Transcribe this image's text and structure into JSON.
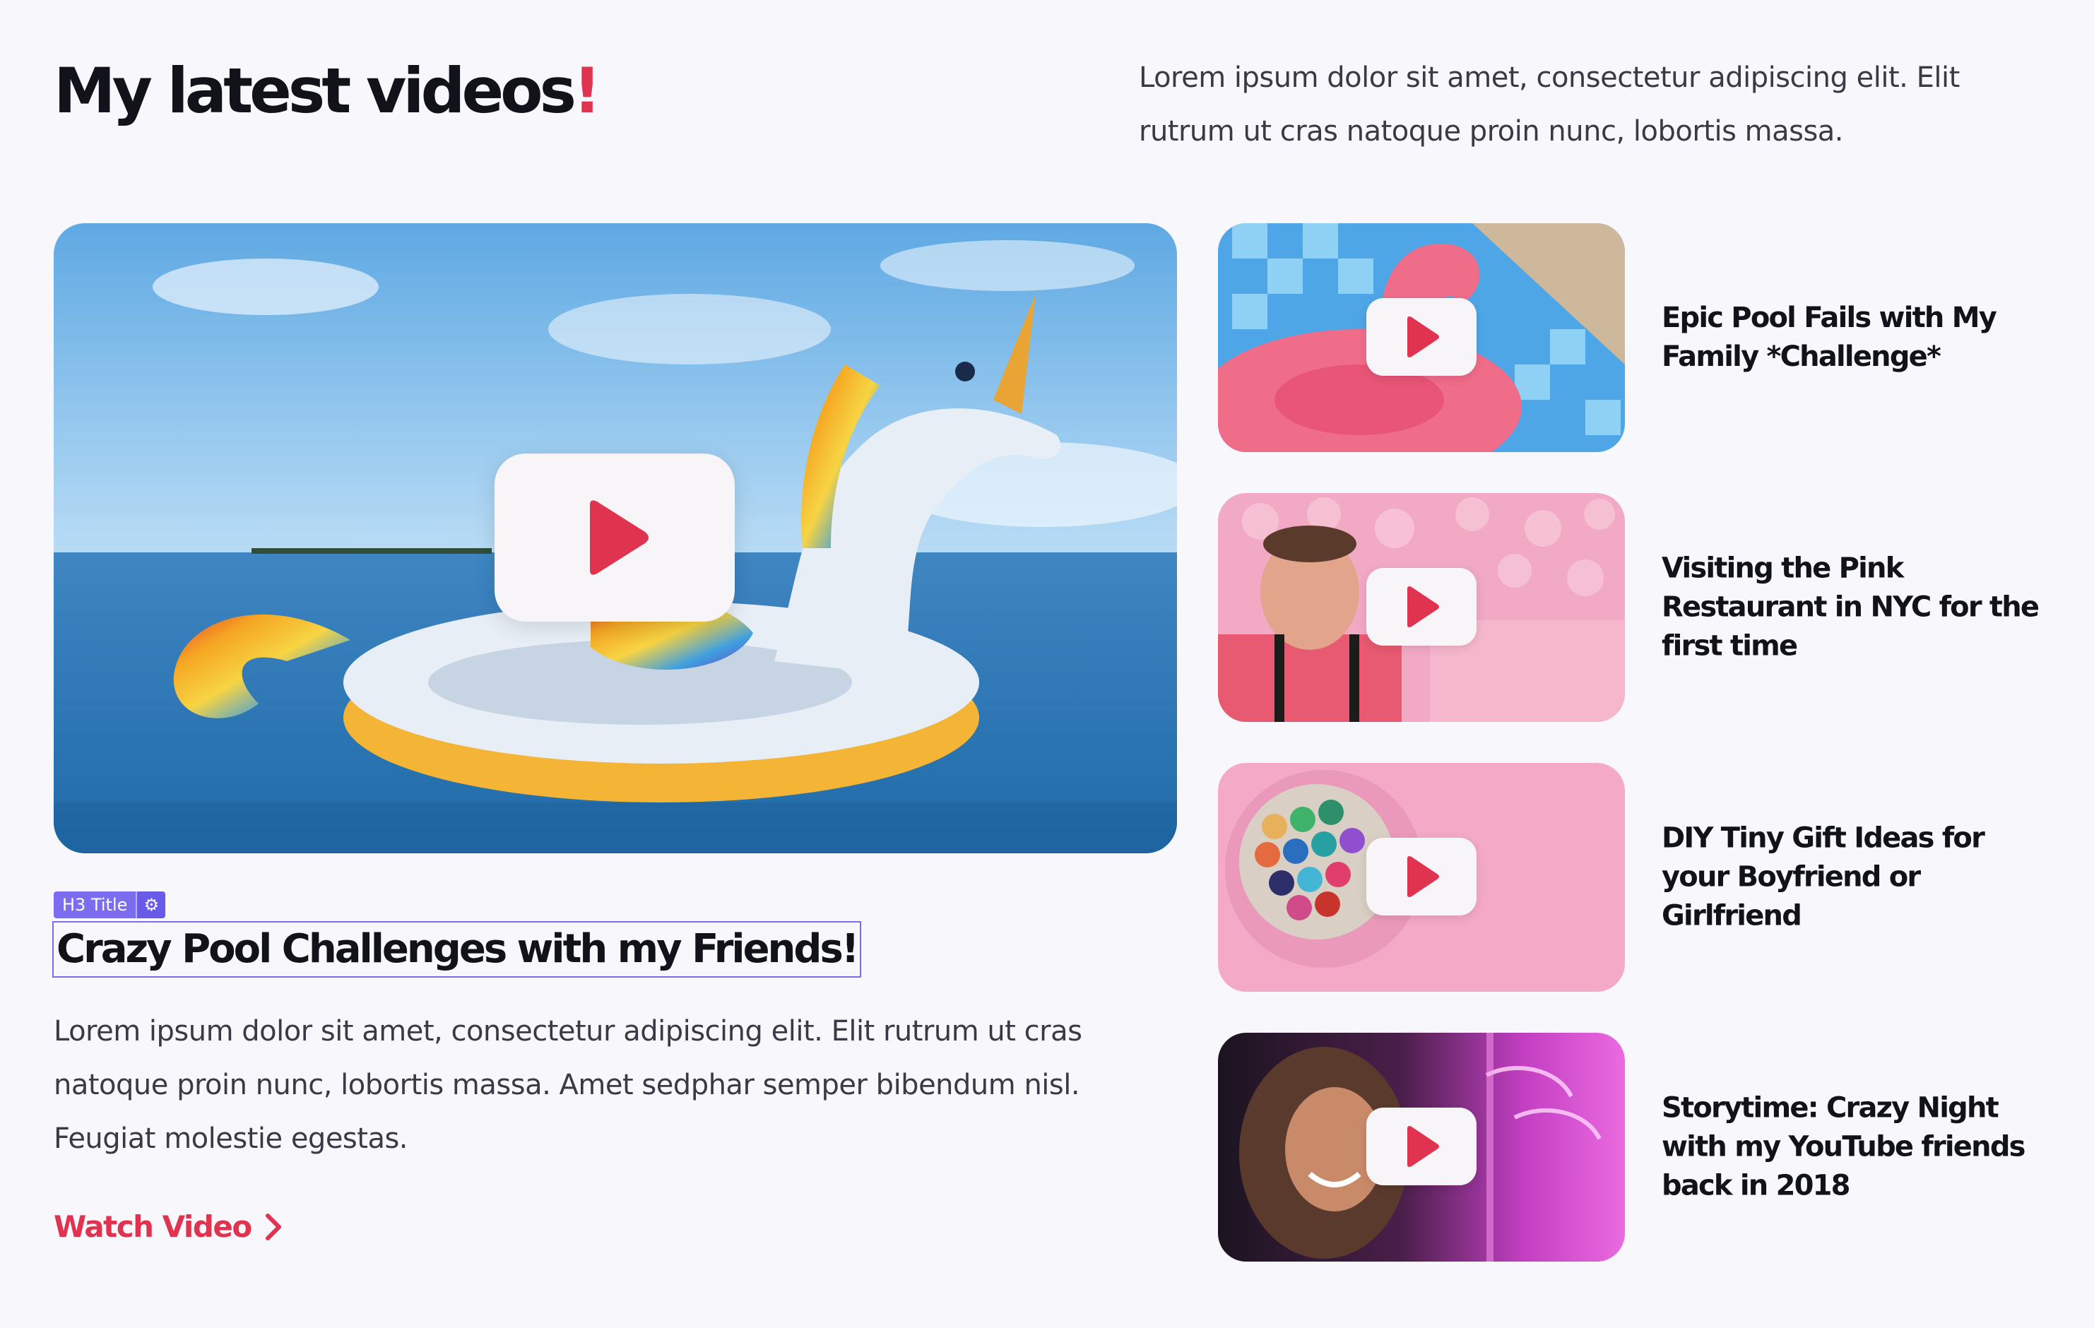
{
  "header": {
    "title": "My latest videos",
    "title_accent": "!",
    "intro": "Lorem ipsum dolor sit amet, consectetur adipiscing elit. Elit rutrum ut cras natoque proin nunc, lobortis massa."
  },
  "featured": {
    "editor_tag": "H3 Title",
    "editor_gear_icon": "gear-icon",
    "title": "Crazy Pool Challenges with my Friends!",
    "description": "Lorem ipsum dolor sit amet, consectetur adipiscing elit. Elit rutrum ut cras natoque proin nunc, lobortis massa. Amet sedphar semper bibendum nisl. Feugiat molestie egestas.",
    "cta": "Watch Video",
    "cta_icon": "chevron-right-icon",
    "play_icon": "play-icon"
  },
  "videos": [
    {
      "title": "Epic Pool Fails with My Family *Challenge*"
    },
    {
      "title": "Visiting the Pink Restaurant in NYC for the first time"
    },
    {
      "title": "DIY Tiny Gift Ideas for your Boyfriend or Girlfriend"
    },
    {
      "title": "Storytime: Crazy Night with my YouTube friends back in 2018"
    }
  ],
  "colors": {
    "accent": "#e0334f",
    "background": "#f8f8fc",
    "text": "#12121a",
    "editor_outline": "#7b6cf0"
  }
}
